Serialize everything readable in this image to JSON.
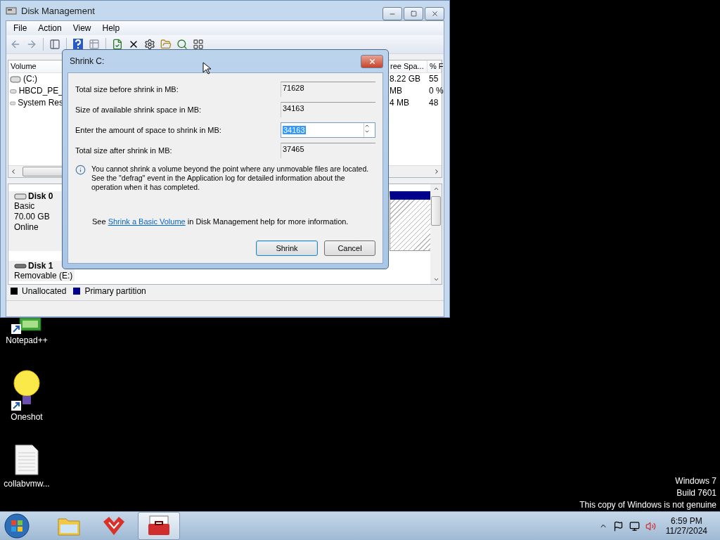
{
  "desktop_icons": [
    {
      "label": "Notepad++",
      "kind": "notepad",
      "shortcut": true
    },
    {
      "label": "Oneshot",
      "kind": "bulb",
      "shortcut": true
    },
    {
      "label": "collabvmw...",
      "kind": "file",
      "shortcut": false
    }
  ],
  "desktop_notice": [
    "Windows 7",
    "Build 7601",
    "This copy of Windows is not genuine"
  ],
  "window": {
    "title": "Disk Management",
    "menu": [
      "File",
      "Action",
      "View",
      "Help"
    ],
    "volume_list": {
      "columns": [
        "Volume",
        "ree Spa...",
        "% F"
      ],
      "rows": [
        {
          "volume": "(C:)",
          "free": "8.22 GB",
          "percent": "55"
        },
        {
          "volume": "HBCD_PE_",
          "free": "MB",
          "percent": "0 %"
        },
        {
          "volume": "System Res",
          "free": "4 MB",
          "percent": "48"
        }
      ]
    },
    "disks": [
      {
        "name": "Disk 0",
        "kind": "fixed",
        "lines": [
          "Basic",
          "70.00 GB",
          "Online"
        ]
      },
      {
        "name": "Disk 1",
        "kind": "removable",
        "lines": [
          "Removable (E:)"
        ]
      }
    ],
    "legend": [
      {
        "label": "Unallocated",
        "color": "#000000"
      },
      {
        "label": "Primary partition",
        "color": "#00008b"
      }
    ]
  },
  "dialog": {
    "title": "Shrink C:",
    "fields": [
      {
        "label": "Total size before shrink in MB:",
        "value": "71628",
        "kind": "readonly"
      },
      {
        "label": "Size of available shrink space in MB:",
        "value": "34163",
        "kind": "readonly"
      },
      {
        "label": "Enter the amount of space to shrink in MB:",
        "value": "34163",
        "kind": "spin"
      },
      {
        "label": "Total size after shrink in MB:",
        "value": "37465",
        "kind": "readonly"
      }
    ],
    "note": "You cannot shrink a volume beyond the point where any unmovable files are located. See the \"defrag\" event in the Application log for detailed information about the operation when it has completed.",
    "help_prefix": "See",
    "help_link": "Shrink a Basic Volume",
    "help_suffix": "in Disk Management help for more information.",
    "buttons": [
      {
        "label": "Shrink",
        "focused": true
      },
      {
        "label": "Cancel",
        "focused": false
      }
    ]
  },
  "taskbar": {
    "apps": [
      {
        "kind": "explorer",
        "selected": false
      },
      {
        "kind": "foxapp",
        "selected": false
      },
      {
        "kind": "toolbox",
        "selected": true
      }
    ],
    "time": "6:59 PM",
    "date": "11/27/2024"
  }
}
